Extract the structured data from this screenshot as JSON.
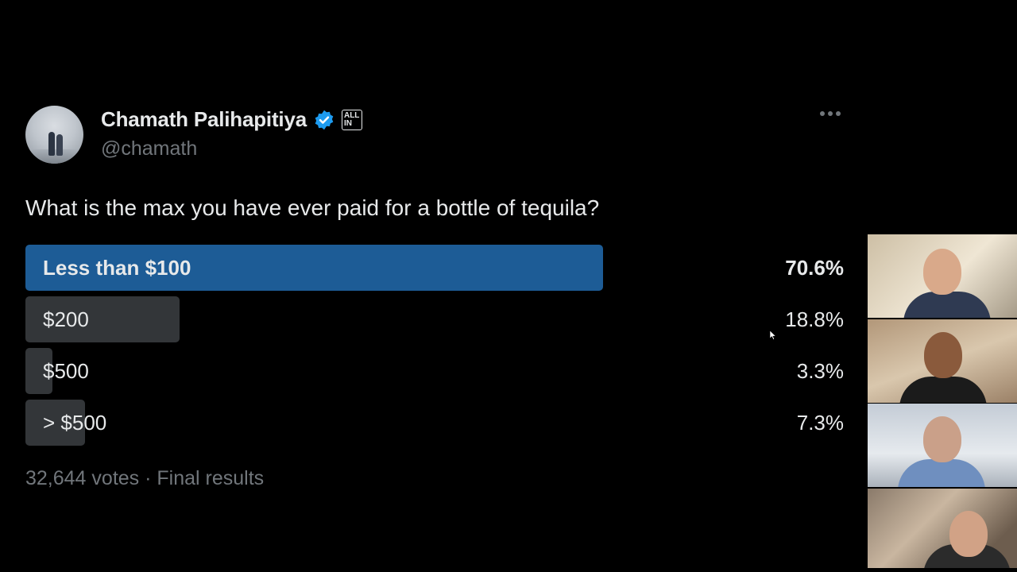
{
  "tweet": {
    "author_name": "Chamath Palihapitiya",
    "handle": "@chamath",
    "badge_label_line1": "ALL",
    "badge_label_line2": "IN",
    "question": "What is the max you have ever paid for a bottle of tequila?"
  },
  "poll": {
    "options": [
      {
        "label": "Less than $100",
        "percent": "70.6%",
        "value": 70.6,
        "winner": true
      },
      {
        "label": "$200",
        "percent": "18.8%",
        "value": 18.8,
        "winner": false
      },
      {
        "label": "$500",
        "percent": "3.3%",
        "value": 3.3,
        "winner": false
      },
      {
        "label": "> $500",
        "percent": "7.3%",
        "value": 7.3,
        "winner": false
      }
    ],
    "votes_text": "32,644 votes · Final results",
    "colors": {
      "winner_bar": "#1d5c96",
      "other_bar": "#333639"
    }
  },
  "icons": [
    "verified-badge-icon",
    "more-options-icon",
    "mouse-cursor-icon"
  ],
  "video_tiles": [
    "participant-video-1",
    "participant-video-2",
    "participant-video-3",
    "participant-video-4"
  ]
}
